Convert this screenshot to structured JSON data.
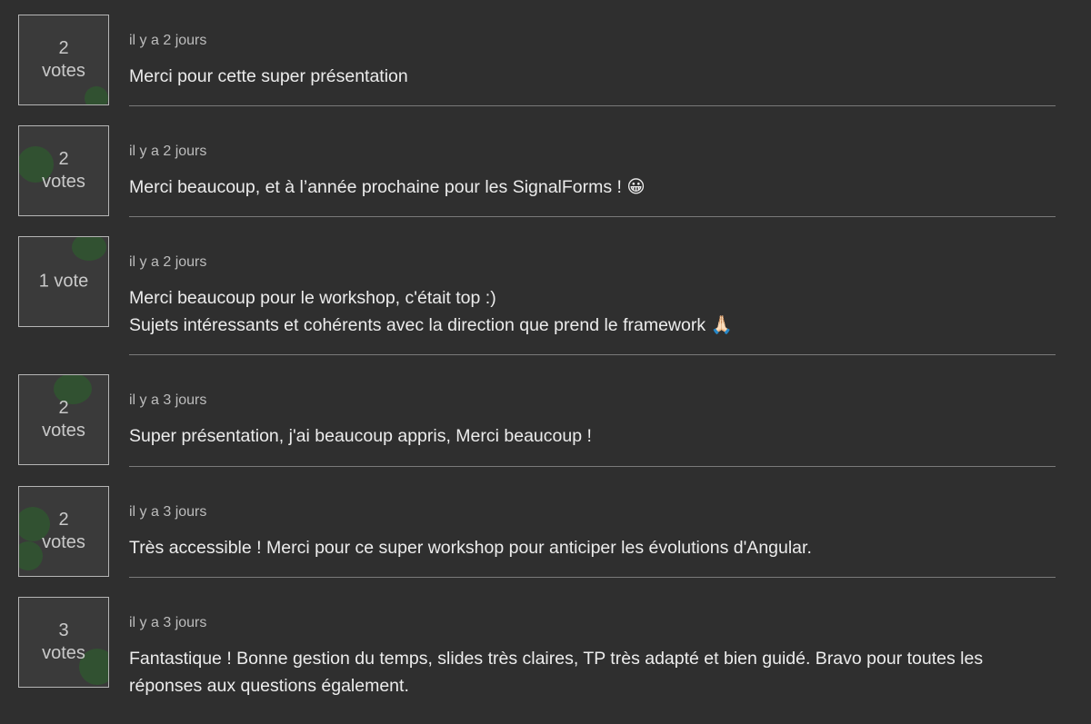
{
  "comments": [
    {
      "votes_count": "2",
      "votes_unit": "votes",
      "time": "il y a 2 jours",
      "text": "Merci pour cette super présentation"
    },
    {
      "votes_count": "2",
      "votes_unit": "votes",
      "time": "il y a 2 jours",
      "text": "Merci beaucoup, et à l’année prochaine pour les SignalForms ! 😀"
    },
    {
      "votes_count": "1 vote",
      "votes_unit": "",
      "time": "il y a 2 jours",
      "text": "Merci beaucoup pour le workshop, c'était top :)\nSujets intéressants et cohérents avec la direction que prend le framework 🙏🏻"
    },
    {
      "votes_count": "2",
      "votes_unit": "votes",
      "time": "il y a 3 jours",
      "text": "Super présentation, j'ai beaucoup appris, Merci beaucoup !"
    },
    {
      "votes_count": "2",
      "votes_unit": "votes",
      "time": "il y a 3 jours",
      "text": "Très accessible ! Merci pour ce super workshop pour anticiper les évolutions d'Angular."
    },
    {
      "votes_count": "3",
      "votes_unit": "votes",
      "time": "il y a 3 jours",
      "text": "Fantastique ! Bonne gestion du temps, slides très claires, TP très adapté et bien guidé. Bravo pour toutes les réponses aux questions également."
    }
  ]
}
